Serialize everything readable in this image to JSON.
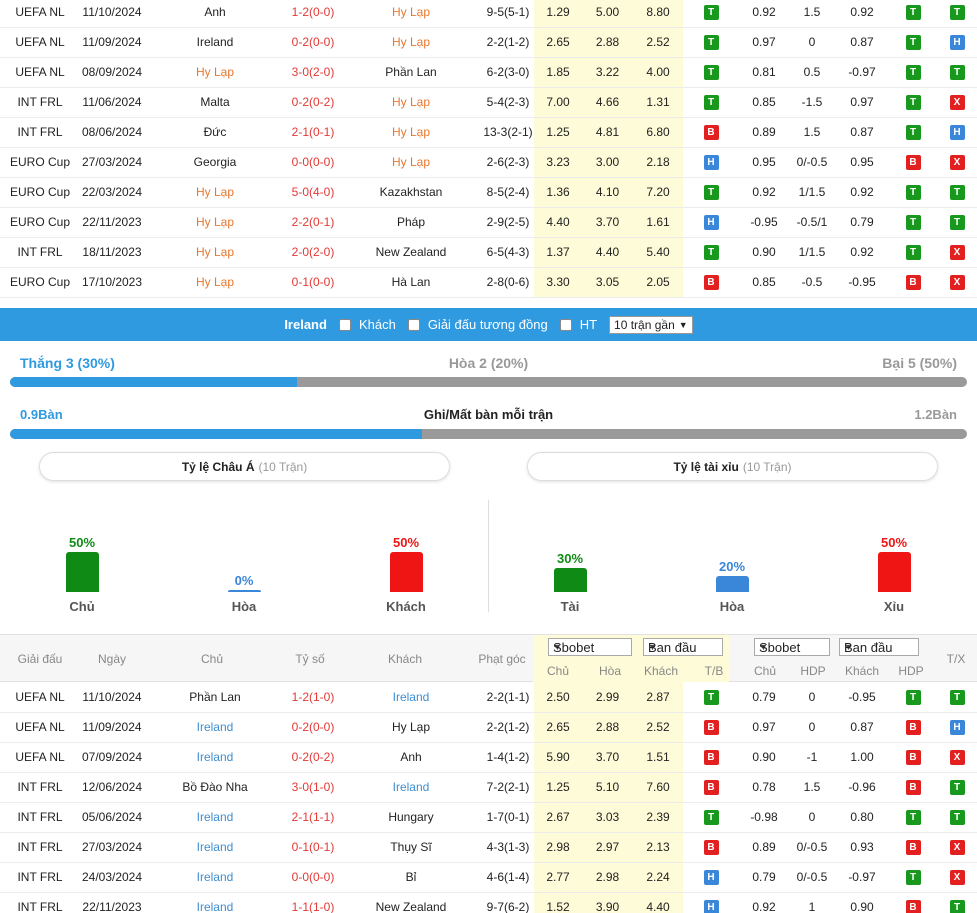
{
  "top_matches": [
    {
      "league": "UEFA NL",
      "date": "11/10/2024",
      "home": "Anh",
      "score": "1-2(0-0)",
      "away": "Hy Lạp",
      "hl": "away",
      "corner": "9-5(5-1)",
      "o1": "1.29",
      "o2": "5.00",
      "o3": "8.80",
      "tb": "T",
      "h1": "0.92",
      "h2": "1.5",
      "h3": "0.92",
      "hdp": "T",
      "tx": "T"
    },
    {
      "league": "UEFA NL",
      "date": "11/09/2024",
      "home": "Ireland",
      "score": "0-2(0-0)",
      "away": "Hy Lạp",
      "hl": "away",
      "corner": "2-2(1-2)",
      "o1": "2.65",
      "o2": "2.88",
      "o3": "2.52",
      "tb": "T",
      "h1": "0.97",
      "h2": "0",
      "h3": "0.87",
      "hdp": "T",
      "tx": "H"
    },
    {
      "league": "UEFA NL",
      "date": "08/09/2024",
      "home": "Hy Lạp",
      "score": "3-0(2-0)",
      "away": "Phần Lan",
      "hl": "home",
      "corner": "6-2(3-0)",
      "o1": "1.85",
      "o2": "3.22",
      "o3": "4.00",
      "tb": "T",
      "h1": "0.81",
      "h2": "0.5",
      "h3": "-0.97",
      "hdp": "T",
      "tx": "T"
    },
    {
      "league": "INT FRL",
      "date": "11/06/2024",
      "home": "Malta",
      "score": "0-2(0-2)",
      "away": "Hy Lạp",
      "hl": "away",
      "corner": "5-4(2-3)",
      "o1": "7.00",
      "o2": "4.66",
      "o3": "1.31",
      "tb": "T",
      "h1": "0.85",
      "h2": "-1.5",
      "h3": "0.97",
      "hdp": "T",
      "tx": "X"
    },
    {
      "league": "INT FRL",
      "date": "08/06/2024",
      "home": "Đức",
      "score": "2-1(0-1)",
      "away": "Hy Lạp",
      "hl": "away",
      "corner": "13-3(2-1)",
      "o1": "1.25",
      "o2": "4.81",
      "o3": "6.80",
      "tb": "B",
      "h1": "0.89",
      "h2": "1.5",
      "h3": "0.87",
      "hdp": "T",
      "tx": "H"
    },
    {
      "league": "EURO Cup",
      "date": "27/03/2024",
      "home": "Georgia",
      "score": "0-0(0-0)",
      "away": "Hy Lạp",
      "hl": "away",
      "corner": "2-6(2-3)",
      "o1": "3.23",
      "o2": "3.00",
      "o3": "2.18",
      "tb": "H",
      "h1": "0.95",
      "h2": "0/-0.5",
      "h3": "0.95",
      "hdp": "B",
      "tx": "X"
    },
    {
      "league": "EURO Cup",
      "date": "22/03/2024",
      "home": "Hy Lạp",
      "score": "5-0(4-0)",
      "away": "Kazakhstan",
      "hl": "home",
      "corner": "8-5(2-4)",
      "o1": "1.36",
      "o2": "4.10",
      "o3": "7.20",
      "tb": "T",
      "h1": "0.92",
      "h2": "1/1.5",
      "h3": "0.92",
      "hdp": "T",
      "tx": "T"
    },
    {
      "league": "EURO Cup",
      "date": "22/11/2023",
      "home": "Hy Lạp",
      "score": "2-2(0-1)",
      "away": "Pháp",
      "hl": "home",
      "corner": "2-9(2-5)",
      "o1": "4.40",
      "o2": "3.70",
      "o3": "1.61",
      "tb": "H",
      "h1": "-0.95",
      "h2": "-0.5/1",
      "h3": "0.79",
      "hdp": "T",
      "tx": "T"
    },
    {
      "league": "INT FRL",
      "date": "18/11/2023",
      "home": "Hy Lạp",
      "score": "2-0(2-0)",
      "away": "New Zealand",
      "hl": "home",
      "corner": "6-5(4-3)",
      "o1": "1.37",
      "o2": "4.40",
      "o3": "5.40",
      "tb": "T",
      "h1": "0.90",
      "h2": "1/1.5",
      "h3": "0.92",
      "hdp": "T",
      "tx": "X"
    },
    {
      "league": "EURO Cup",
      "date": "17/10/2023",
      "home": "Hy Lạp",
      "score": "0-1(0-0)",
      "away": "Hà Lan",
      "hl": "home",
      "corner": "2-8(0-6)",
      "o1": "3.30",
      "o2": "3.05",
      "o3": "2.05",
      "tb": "B",
      "h1": "0.85",
      "h2": "-0.5",
      "h3": "-0.95",
      "hdp": "B",
      "tx": "X"
    }
  ],
  "filter": {
    "team": "Ireland",
    "away_label": "Khách",
    "similar_label": "Giải đấu tương đồng",
    "ht_label": "HT",
    "select_value": "10 trận gần"
  },
  "wdl": {
    "win": "Thắng 3 (30%)",
    "draw": "Hòa 2 (20%)",
    "lose": "Bại 5 (50%)",
    "win_fraction": 0.3
  },
  "goals": {
    "scored": "0.9Bàn",
    "title": "Ghi/Mất bàn mỗi trận",
    "conceded": "1.2Bàn",
    "scored_fraction": 0.43
  },
  "asian": {
    "title": "Tỷ lệ Châu Á",
    "count": "(10 Trận)",
    "items": [
      {
        "pct": "50%",
        "label": "Chủ",
        "value": 0.5,
        "color": "#0f8a14"
      },
      {
        "pct": "0%",
        "label": "Hòa",
        "value": 0,
        "color": "#3a86d9"
      },
      {
        "pct": "50%",
        "label": "Khách",
        "value": 0.5,
        "color": "#f01515"
      }
    ]
  },
  "ou": {
    "title": "Tỷ lệ tài xỉu",
    "count": "(10 Trận)",
    "items": [
      {
        "pct": "30%",
        "label": "Tài",
        "value": 0.3,
        "color": "#0f8a14"
      },
      {
        "pct": "20%",
        "label": "Hòa",
        "value": 0.2,
        "color": "#3a86d9"
      },
      {
        "pct": "50%",
        "label": "Xỉu",
        "value": 0.5,
        "color": "#f01515"
      }
    ]
  },
  "header": {
    "league": "Giải đấu",
    "date": "Ngày",
    "home": "Chủ",
    "score": "Tỷ số",
    "away": "Khách",
    "corner": "Phạt góc",
    "bookmaker1": "Sbobet",
    "type1": "Ban đầu",
    "bookmaker2": "Sbobet",
    "type2": "Ban đầu",
    "sub_home": "Chủ",
    "sub_draw": "Hòa",
    "sub_away": "Khách",
    "sub_tb": "T/B",
    "sub_home2": "Chủ",
    "sub_hdp": "HDP",
    "sub_away2": "Khách",
    "sub_hdp2": "HDP",
    "tx": "T/X"
  },
  "bottom_matches": [
    {
      "league": "UEFA NL",
      "date": "11/10/2024",
      "home": "Phần Lan",
      "score": "1-2(1-0)",
      "away": "Ireland",
      "hl": "away",
      "corner": "2-2(1-1)",
      "o1": "2.50",
      "o2": "2.99",
      "o3": "2.87",
      "tb": "T",
      "h1": "0.79",
      "h2": "0",
      "h3": "-0.95",
      "hdp": "T",
      "tx": "T"
    },
    {
      "league": "UEFA NL",
      "date": "11/09/2024",
      "home": "Ireland",
      "score": "0-2(0-0)",
      "away": "Hy Lạp",
      "hl": "home",
      "corner": "2-2(1-2)",
      "o1": "2.65",
      "o2": "2.88",
      "o3": "2.52",
      "tb": "B",
      "h1": "0.97",
      "h2": "0",
      "h3": "0.87",
      "hdp": "B",
      "tx": "H"
    },
    {
      "league": "UEFA NL",
      "date": "07/09/2024",
      "home": "Ireland",
      "score": "0-2(0-2)",
      "away": "Anh",
      "hl": "home",
      "corner": "1-4(1-2)",
      "o1": "5.90",
      "o2": "3.70",
      "o3": "1.51",
      "tb": "B",
      "h1": "0.90",
      "h2": "-1",
      "h3": "1.00",
      "hdp": "B",
      "tx": "X"
    },
    {
      "league": "INT FRL",
      "date": "12/06/2024",
      "home": "Bồ Đào Nha",
      "score": "3-0(1-0)",
      "away": "Ireland",
      "hl": "away",
      "corner": "7-2(2-1)",
      "o1": "1.25",
      "o2": "5.10",
      "o3": "7.60",
      "tb": "B",
      "h1": "0.78",
      "h2": "1.5",
      "h3": "-0.96",
      "hdp": "B",
      "tx": "T"
    },
    {
      "league": "INT FRL",
      "date": "05/06/2024",
      "home": "Ireland",
      "score": "2-1(1-1)",
      "away": "Hungary",
      "hl": "home",
      "corner": "1-7(0-1)",
      "o1": "2.67",
      "o2": "3.03",
      "o3": "2.39",
      "tb": "T",
      "h1": "-0.98",
      "h2": "0",
      "h3": "0.80",
      "hdp": "T",
      "tx": "T"
    },
    {
      "league": "INT FRL",
      "date": "27/03/2024",
      "home": "Ireland",
      "score": "0-1(0-1)",
      "away": "Thụy Sĩ",
      "hl": "home",
      "corner": "4-3(1-3)",
      "o1": "2.98",
      "o2": "2.97",
      "o3": "2.13",
      "tb": "B",
      "h1": "0.89",
      "h2": "0/-0.5",
      "h3": "0.93",
      "hdp": "B",
      "tx": "X"
    },
    {
      "league": "INT FRL",
      "date": "24/03/2024",
      "home": "Ireland",
      "score": "0-0(0-0)",
      "away": "Bỉ",
      "hl": "home",
      "corner": "4-6(1-4)",
      "o1": "2.77",
      "o2": "2.98",
      "o3": "2.24",
      "tb": "H",
      "h1": "0.79",
      "h2": "0/-0.5",
      "h3": "-0.97",
      "hdp": "T",
      "tx": "X"
    },
    {
      "league": "INT FRL",
      "date": "22/11/2023",
      "home": "Ireland",
      "score": "1-1(1-0)",
      "away": "New Zealand",
      "hl": "home",
      "corner": "9-7(6-2)",
      "o1": "1.52",
      "o2": "3.90",
      "o3": "4.40",
      "tb": "H",
      "h1": "0.92",
      "h2": "1",
      "h3": "0.90",
      "hdp": "B",
      "tx": "T"
    }
  ]
}
